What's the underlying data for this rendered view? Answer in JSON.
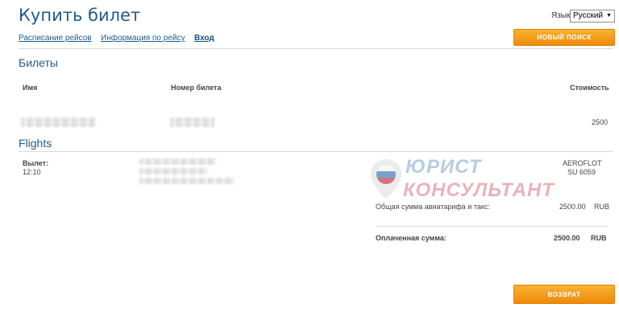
{
  "header": {
    "title": "Купить билет",
    "language_label": "Язык:",
    "language_value": "Русский"
  },
  "nav": {
    "links": [
      "Расписание рейсов",
      "Информация по рейсу",
      "Вход"
    ],
    "new_search_button": "НОВЫЙ ПОИСК"
  },
  "tickets": {
    "section_title": "Билеты",
    "col_name": "Имя",
    "col_ticket_number": "Номер билета",
    "col_price": "Стоимость",
    "row_price": "2500"
  },
  "flights": {
    "section_title": "Flights",
    "departure_label": "Вылет:",
    "departure_time": "12:10",
    "airline": "AEROFLOT",
    "flight_number": "SU 6059",
    "total_fare_label": "Общая сумма авиатарифа и такс:",
    "total_fare_value": "2500.00",
    "total_fare_currency": "RUB",
    "paid_label": "Оплаченная сумма:",
    "paid_value": "2500.00",
    "paid_currency": "RUB"
  },
  "watermark": {
    "line1": "ЮРИСТ",
    "line2": "КОНСУЛЬТАНТ"
  },
  "actions": {
    "return_button": "ВОЗВРАТ"
  },
  "colors": {
    "title_blue": "#1f5b8c",
    "button_orange": "#f39c12",
    "watermark_blue": "#2d6fb5",
    "watermark_red": "#c0283a"
  }
}
